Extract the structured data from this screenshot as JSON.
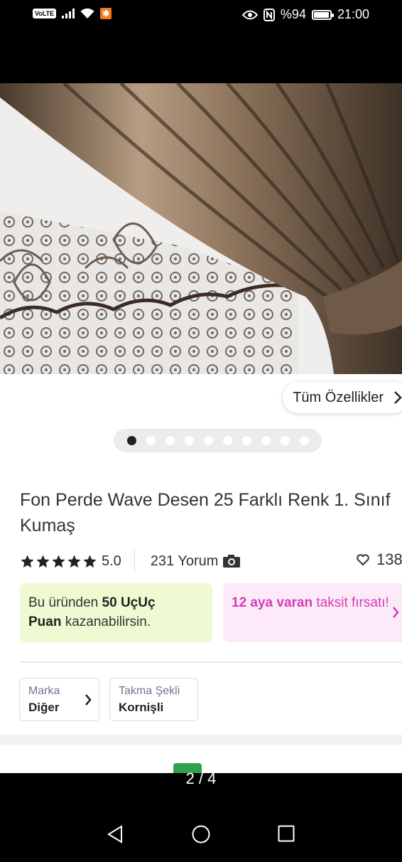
{
  "status_bar": {
    "volte": "VoLTE",
    "battery_text": "%94",
    "time": "21:00",
    "icons": [
      "signal-icon",
      "wifi-icon",
      "app-notification-icon",
      "eye-icon",
      "nfc-icon",
      "battery-icon"
    ]
  },
  "product": {
    "features_button": "Tüm Özellikler",
    "image_count": 10,
    "active_image_index": 0,
    "title": "Fon Perde Wave Desen 25 Farklı Renk 1. Sınıf Kumaş",
    "rating": 5,
    "rating_text": "5.0",
    "reviews": "231 Yorum",
    "favorites": "138"
  },
  "points_card": {
    "p1": "Bu üründen ",
    "b1": "50 UçUç",
    "b2": "Puan",
    "p2": " kazanabilirsin."
  },
  "installment_card": {
    "b": "12 aya varan",
    "p": " taksit fırsatı!"
  },
  "attributes": [
    {
      "label": "Marka",
      "value": "Diğer"
    },
    {
      "label": "Takma Şekli",
      "value": "Kornişli"
    }
  ],
  "page_indicator": "2 / 4",
  "colors": {
    "brand_orange": "#f27a1a",
    "points_bg": "#f0fad2",
    "installment_bg": "#fdeaf8",
    "installment_text": "#d23fb7",
    "attr_label": "#6b7794"
  }
}
